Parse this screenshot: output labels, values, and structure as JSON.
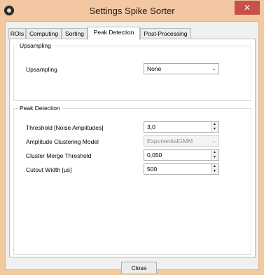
{
  "window": {
    "title": "Settings Spike Sorter",
    "close_glyph": "✕"
  },
  "tabs": [
    {
      "label": "ROIs",
      "active": false
    },
    {
      "label": "Computing",
      "active": false
    },
    {
      "label": "Sorting",
      "active": false
    },
    {
      "label": "Peak Detection",
      "active": true
    },
    {
      "label": "Post-Processing",
      "active": false
    }
  ],
  "upsampling_group": {
    "title": "Upsampling",
    "upsampling_label": "Upsampling",
    "upsampling_value": "None"
  },
  "peak_detection_group": {
    "title": "Peak Detection",
    "threshold_label": "Threshold [Noise Amplitudes]",
    "threshold_value": "3,0",
    "clustering_model_label": "Amplitude Clustering Model",
    "clustering_model_value": "ExponentialGMM",
    "merge_threshold_label": "Cluster Merge Threshold",
    "merge_threshold_value": "0,050",
    "cutout_width_label": "Cutout Width [µs]",
    "cutout_width_value": "500"
  },
  "footer": {
    "close_label": "Close"
  },
  "icons": {
    "app": "app-icon",
    "dropdown": "chevron-down-icon",
    "spinner": "spinner-arrows-icon"
  },
  "colors": {
    "window_frame": "#f2c99f",
    "close_button": "#c7504a",
    "client_background": "#f0f0f0",
    "panel_background": "#ffffff"
  }
}
